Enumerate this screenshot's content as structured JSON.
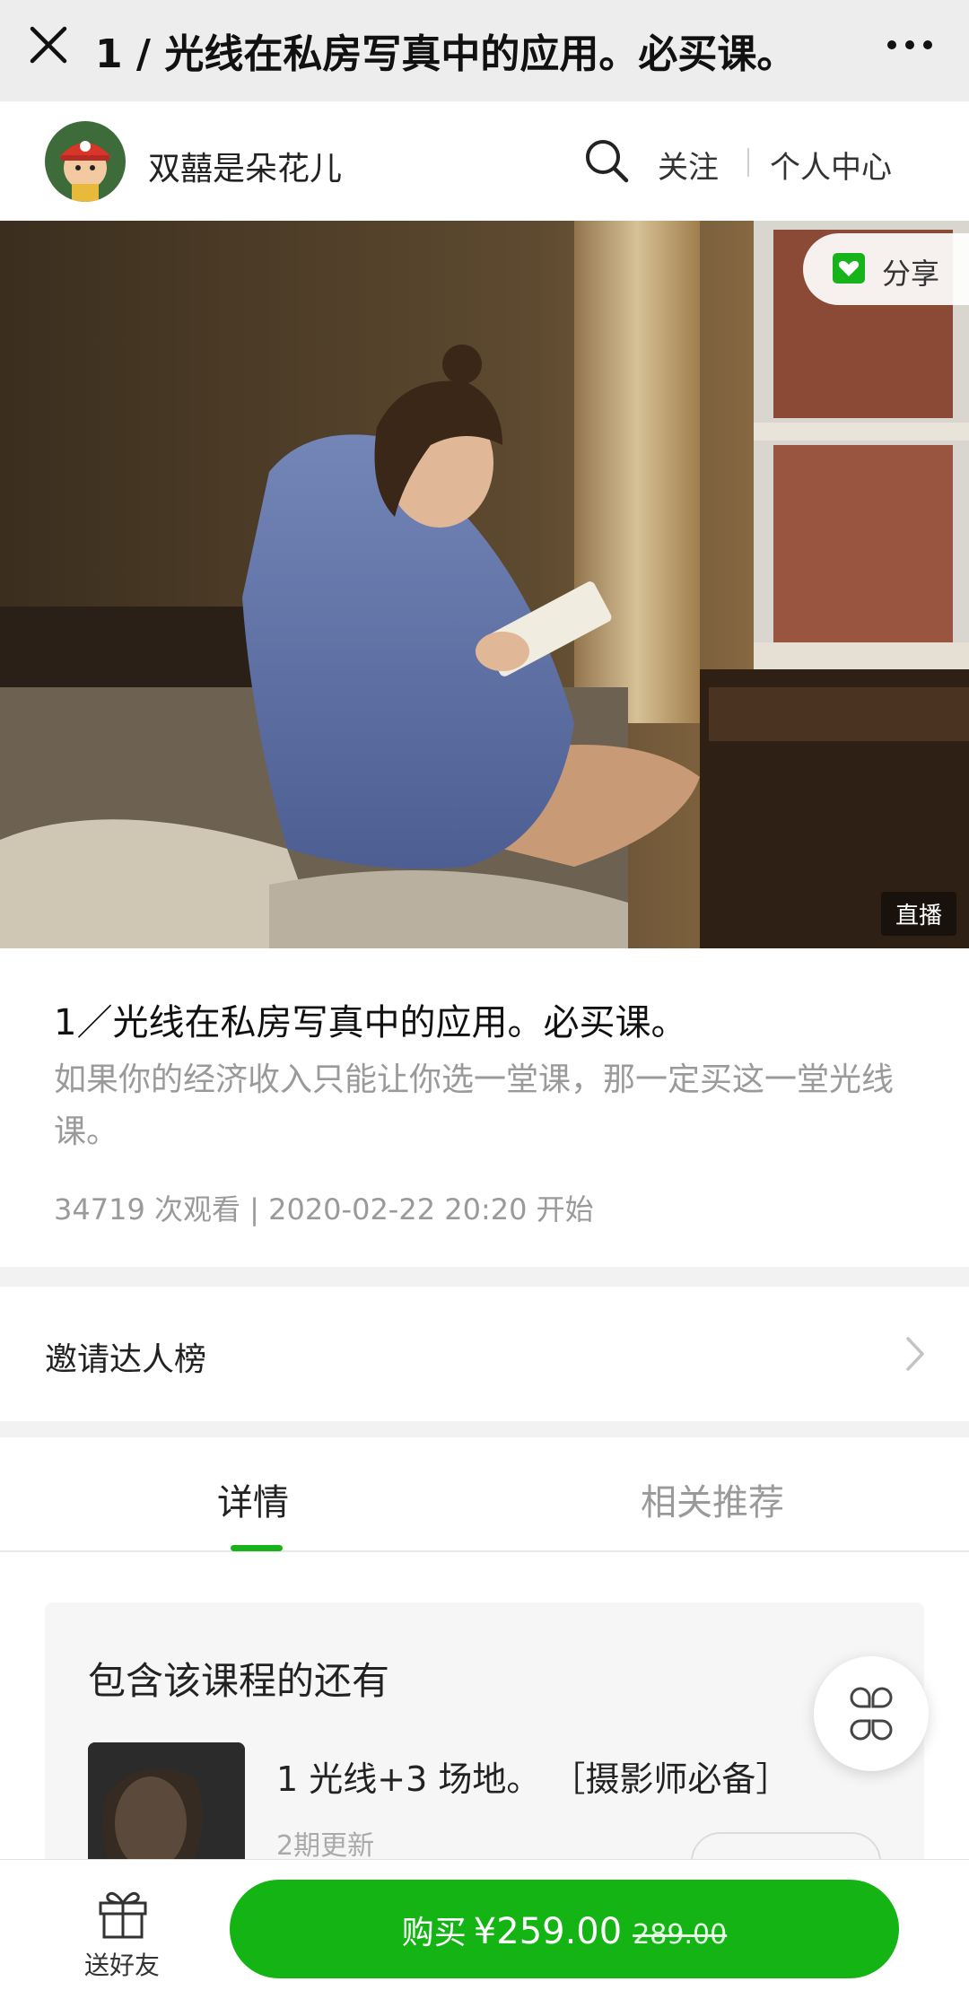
{
  "window": {
    "title": "1 / 光线在私房写真中的应用。必买课。",
    "close_icon": "close-icon",
    "more_icon": "more-dots-icon"
  },
  "header": {
    "shop_name": "双囍是朵花儿",
    "avatar_icon": "avatar",
    "search_icon": "search-icon",
    "follow_label": "关注",
    "center_label": "个人中心"
  },
  "hero": {
    "share_label": "分享",
    "share_icon": "share-icon",
    "live_badge": "直播"
  },
  "course": {
    "title": "1／光线在私房写真中的应用。必买课。",
    "description": "如果你的经济收入只能让你选一堂课，那一定买这一堂光线课。",
    "meta": "34719 次观看 | 2020-02-22 20:20 开始"
  },
  "invite": {
    "label": "邀请达人榜",
    "chevron_icon": "chevron-right-icon"
  },
  "tabs": [
    {
      "label": "详情",
      "active": true
    },
    {
      "label": "相关推荐",
      "active": false
    }
  ],
  "bundle": {
    "heading": "包含该课程的还有",
    "item_title": "1 光线+3 场地。 ［摄影师必备］",
    "item_subtitle": "2期更新"
  },
  "float_icon": "grid-icon",
  "bottom": {
    "gift_label": "送好友",
    "gift_icon": "gift-icon",
    "buy_label": "购买",
    "price": "¥259.00",
    "original_price": "289.00"
  },
  "colors": {
    "accent": "#18b31a",
    "buy_button": "#14b414",
    "muted_text": "#9a9a9a"
  }
}
